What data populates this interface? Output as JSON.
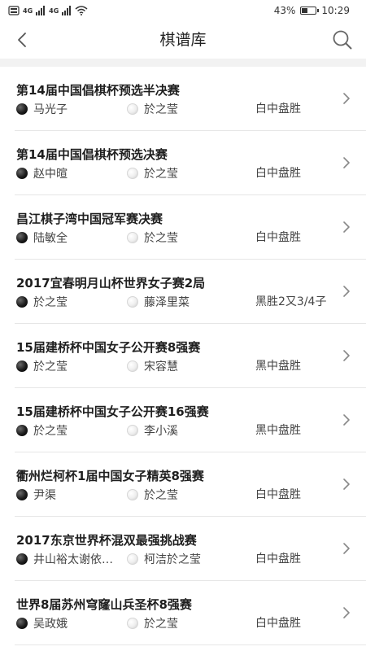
{
  "status_bar": {
    "signal_left": "4G",
    "signal_right": "4G",
    "battery": "43%",
    "time": "10:29"
  },
  "nav": {
    "title": "棋谱库"
  },
  "icons": {
    "back": "chevron-left-icon",
    "search": "search-icon",
    "item_arrow": "chevron-right-icon",
    "black_stone": "black-stone-icon",
    "white_stone": "white-stone-icon"
  },
  "games": [
    {
      "title": "第14届中国倡棋杯预选半决赛",
      "black": "马光子",
      "white": "於之莹",
      "result": "白中盘胜"
    },
    {
      "title": "第14届中国倡棋杯预选决赛",
      "black": "赵中暄",
      "white": "於之莹",
      "result": "白中盘胜"
    },
    {
      "title": "昌江棋子湾中国冠军赛决赛",
      "black": "陆敏全",
      "white": "於之莹",
      "result": "白中盘胜"
    },
    {
      "title": "2017宜春明月山杯世界女子赛2局",
      "black": "於之莹",
      "white": "藤泽里菜",
      "result": "黑胜2又3/4子"
    },
    {
      "title": "15届建桥杯中国女子公开赛8强赛",
      "black": "於之莹",
      "white": "宋容慧",
      "result": "黑中盘胜"
    },
    {
      "title": "15届建桥杯中国女子公开赛16强赛",
      "black": "於之莹",
      "white": "李小溪",
      "result": "黑中盘胜"
    },
    {
      "title": "衢州烂柯杯1届中国女子精英8强赛",
      "black": "尹渠",
      "white": "於之莹",
      "result": "白中盘胜"
    },
    {
      "title": "2017东京世界杯混双最强挑战赛",
      "black": "井山裕太谢依…",
      "white": "柯洁於之莹",
      "result": "白中盘胜"
    },
    {
      "title": "世界8届苏州穹窿山兵圣杯8强赛",
      "black": "吴政娥",
      "white": "於之莹",
      "result": "白中盘胜"
    }
  ]
}
